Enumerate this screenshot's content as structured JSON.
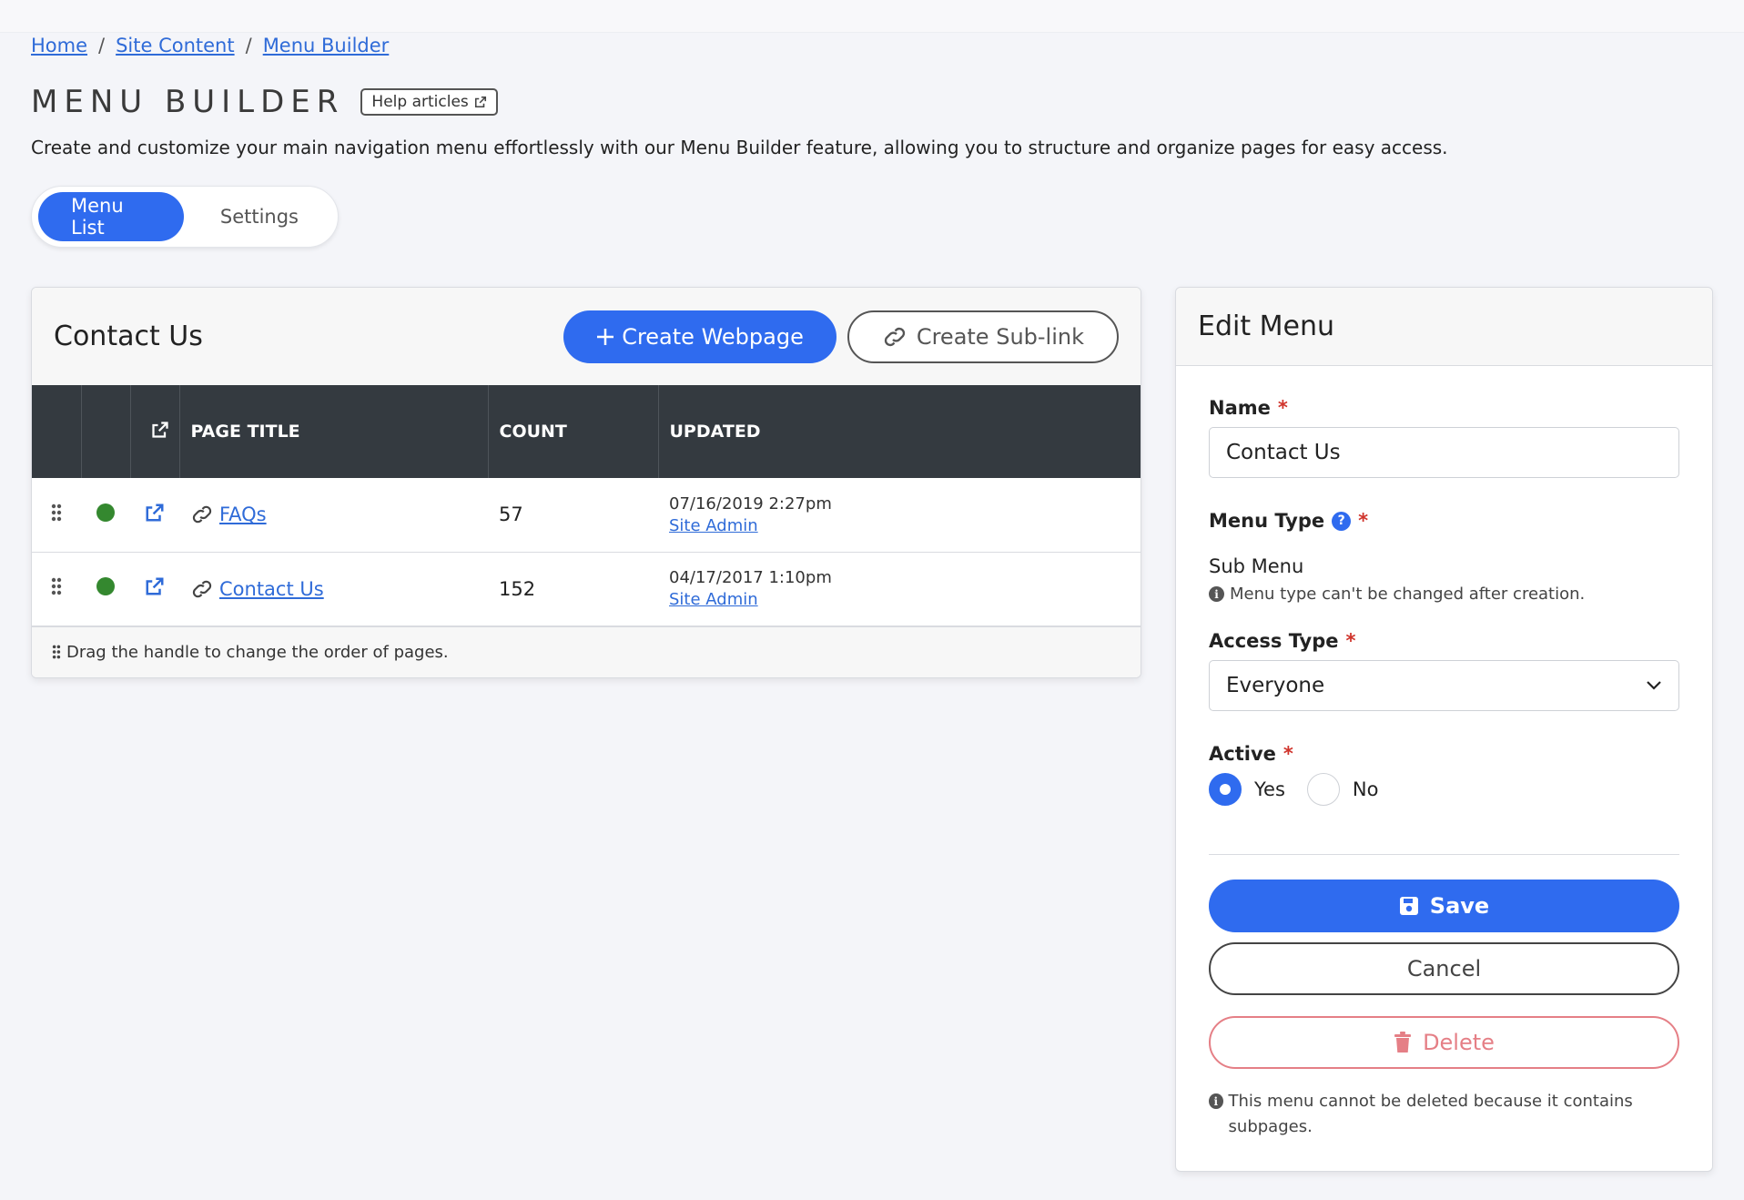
{
  "breadcrumb": {
    "items": [
      "Home",
      "Site Content",
      "Menu Builder"
    ],
    "separator": "/"
  },
  "header": {
    "title": "MENU BUILDER",
    "help_label": "Help articles",
    "description": "Create and customize your main navigation menu effortlessly with our Menu Builder feature, allowing you to structure and organize pages for easy access."
  },
  "tabs": [
    {
      "label": "Menu List",
      "active": true
    },
    {
      "label": "Settings",
      "active": false
    }
  ],
  "list_card": {
    "title": "Contact Us",
    "create_webpage_label": "Create Webpage",
    "create_sublink_label": "Create Sub-link",
    "columns": {
      "page_title": "PAGE TITLE",
      "count": "COUNT",
      "updated": "UPDATED"
    },
    "rows": [
      {
        "title": "FAQs",
        "count": "57",
        "updated_date": "07/16/2019 2:27pm",
        "updated_by": "Site Admin",
        "status_color": "#34882f"
      },
      {
        "title": "Contact Us",
        "count": "152",
        "updated_date": "04/17/2017 1:10pm",
        "updated_by": "Site Admin",
        "status_color": "#34882f"
      }
    ],
    "footer_hint": "Drag the handle to change the order of pages."
  },
  "edit_panel": {
    "title": "Edit Menu",
    "name_label": "Name",
    "name_value": "Contact Us",
    "menu_type_label": "Menu Type",
    "menu_type_value": "Sub Menu",
    "menu_type_hint": "Menu type can't be changed after creation.",
    "access_type_label": "Access Type",
    "access_type_value": "Everyone",
    "active_label": "Active",
    "active_options": {
      "yes": "Yes",
      "no": "No"
    },
    "active_selected": "Yes",
    "save_label": "Save",
    "cancel_label": "Cancel",
    "delete_label": "Delete",
    "delete_hint": "This menu cannot be deleted because it contains subpages."
  },
  "colors": {
    "primary": "#2f6bef",
    "dark_header": "#343a40",
    "status_active": "#34882f",
    "danger": "#e57f86",
    "required": "#d0342c"
  }
}
